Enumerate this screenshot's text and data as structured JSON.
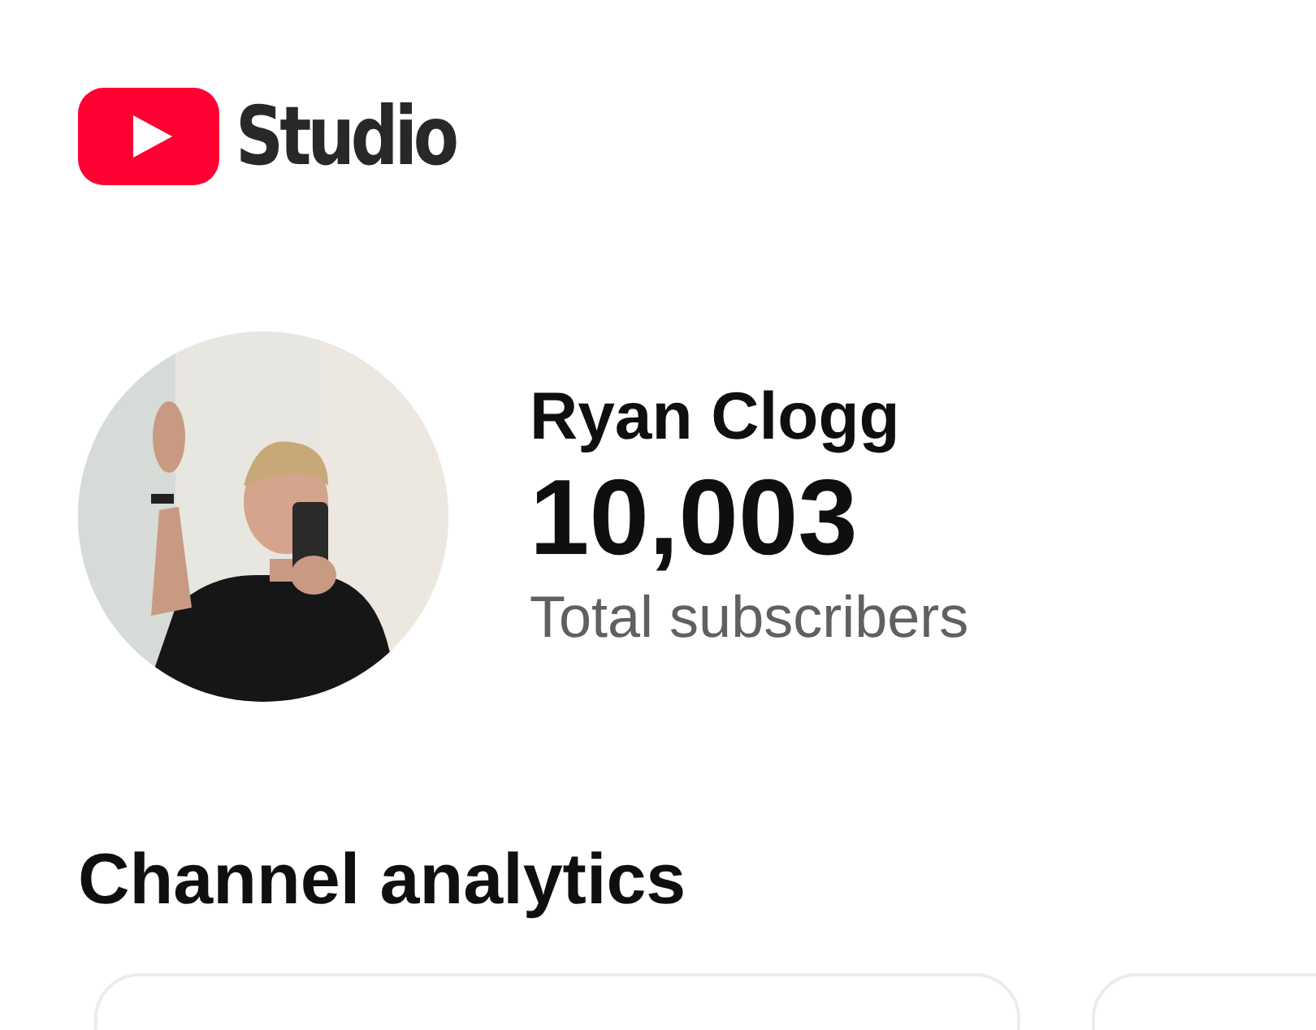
{
  "header": {
    "logo_text": "Studio"
  },
  "channel": {
    "name": "Ryan Clogg",
    "subscriber_count": "10,003",
    "subscriber_label": "Total subscribers"
  },
  "analytics": {
    "title": "Channel analytics",
    "cards": [
      {
        "kind": "card"
      },
      {
        "kind": "card"
      }
    ]
  }
}
